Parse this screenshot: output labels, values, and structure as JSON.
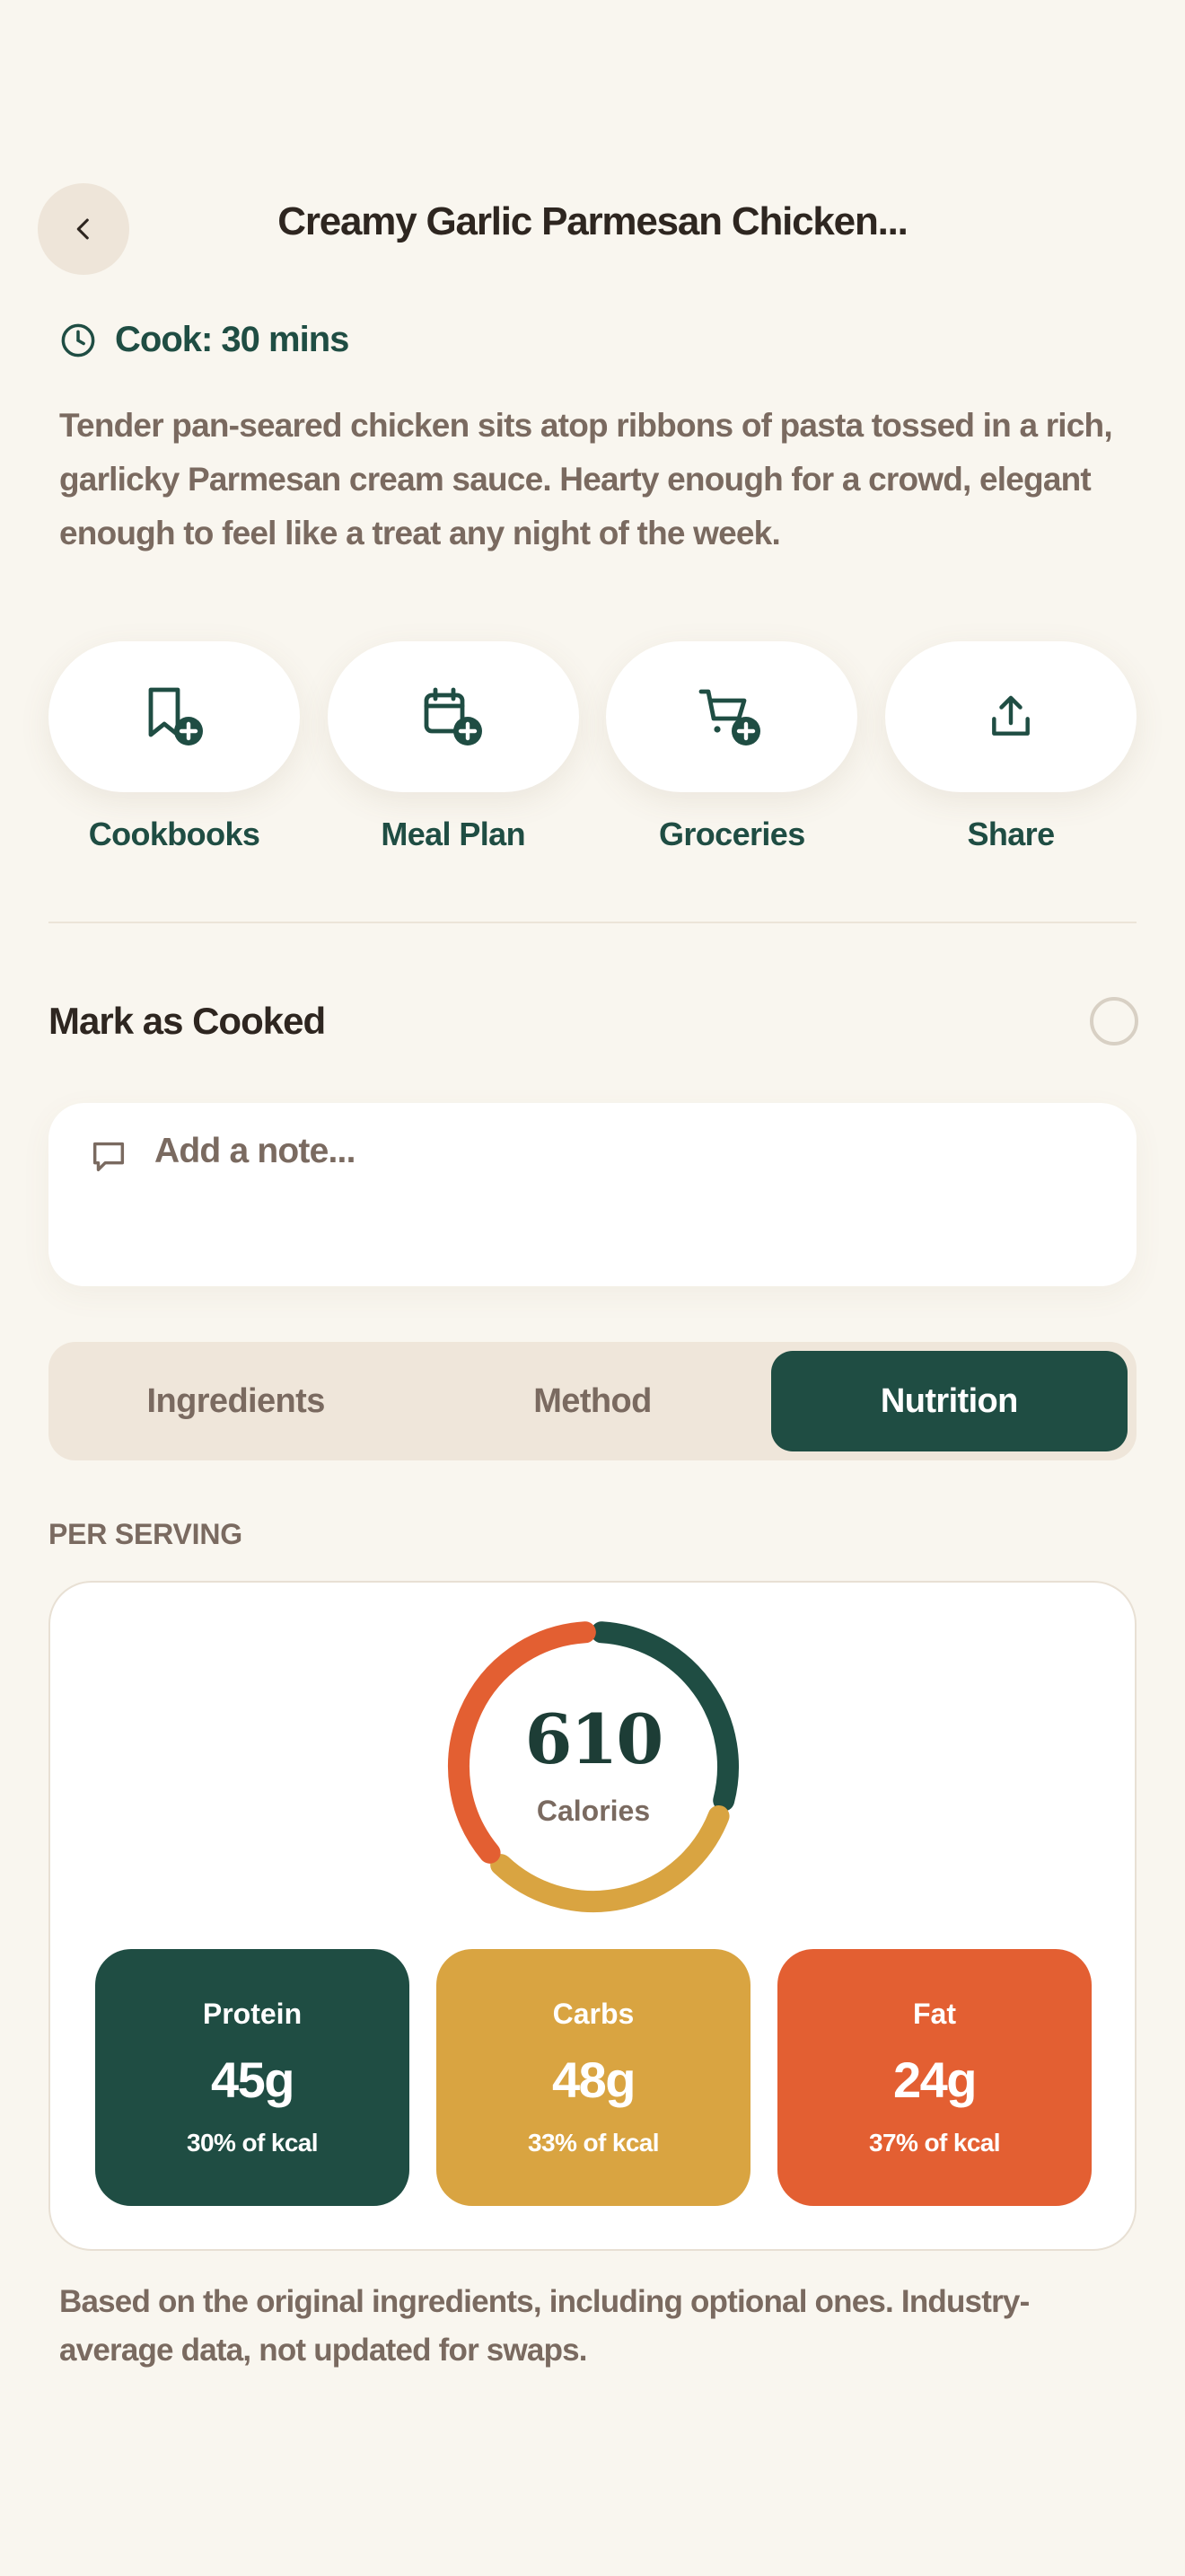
{
  "header": {
    "title": "Creamy Garlic Parmesan Chicken..."
  },
  "cook": {
    "time_label": "Cook: 30 mins"
  },
  "description": "Tender pan-seared chicken sits atop ribbons of pasta tossed in a rich, garlicky Parmesan cream sauce. Hearty enough for a crowd, elegant enough to feel like a treat any night of the week.",
  "actions": [
    {
      "label": "Cookbooks",
      "icon": "bookmark-plus-icon"
    },
    {
      "label": "Meal Plan",
      "icon": "calendar-plus-icon"
    },
    {
      "label": "Groceries",
      "icon": "cart-plus-icon"
    },
    {
      "label": "Share",
      "icon": "share-icon"
    }
  ],
  "mark_cooked": {
    "label": "Mark as Cooked",
    "checked": false
  },
  "note": {
    "placeholder": "Add a note..."
  },
  "tabs": [
    {
      "label": "Ingredients",
      "active": false
    },
    {
      "label": "Method",
      "active": false
    },
    {
      "label": "Nutrition",
      "active": true
    }
  ],
  "nutrition": {
    "section_label": "PER SERVING",
    "calories": "610",
    "calories_label": "Calories",
    "macros": [
      {
        "name": "Protein",
        "value": "45g",
        "pct_label": "30% of kcal",
        "pct": 30,
        "color": "#1f4d43"
      },
      {
        "name": "Carbs",
        "value": "48g",
        "pct_label": "33% of kcal",
        "pct": 33,
        "color": "#d9a441"
      },
      {
        "name": "Fat",
        "value": "24g",
        "pct_label": "37% of kcal",
        "pct": 37,
        "color": "#e35f32"
      }
    ],
    "footnote": "Based on the original ingredients, including optional ones. Industry-average data, not updated for swaps."
  },
  "colors": {
    "background": "#f9f6ef",
    "brand": "#1f4d43",
    "muted_text": "#7a6a60"
  }
}
